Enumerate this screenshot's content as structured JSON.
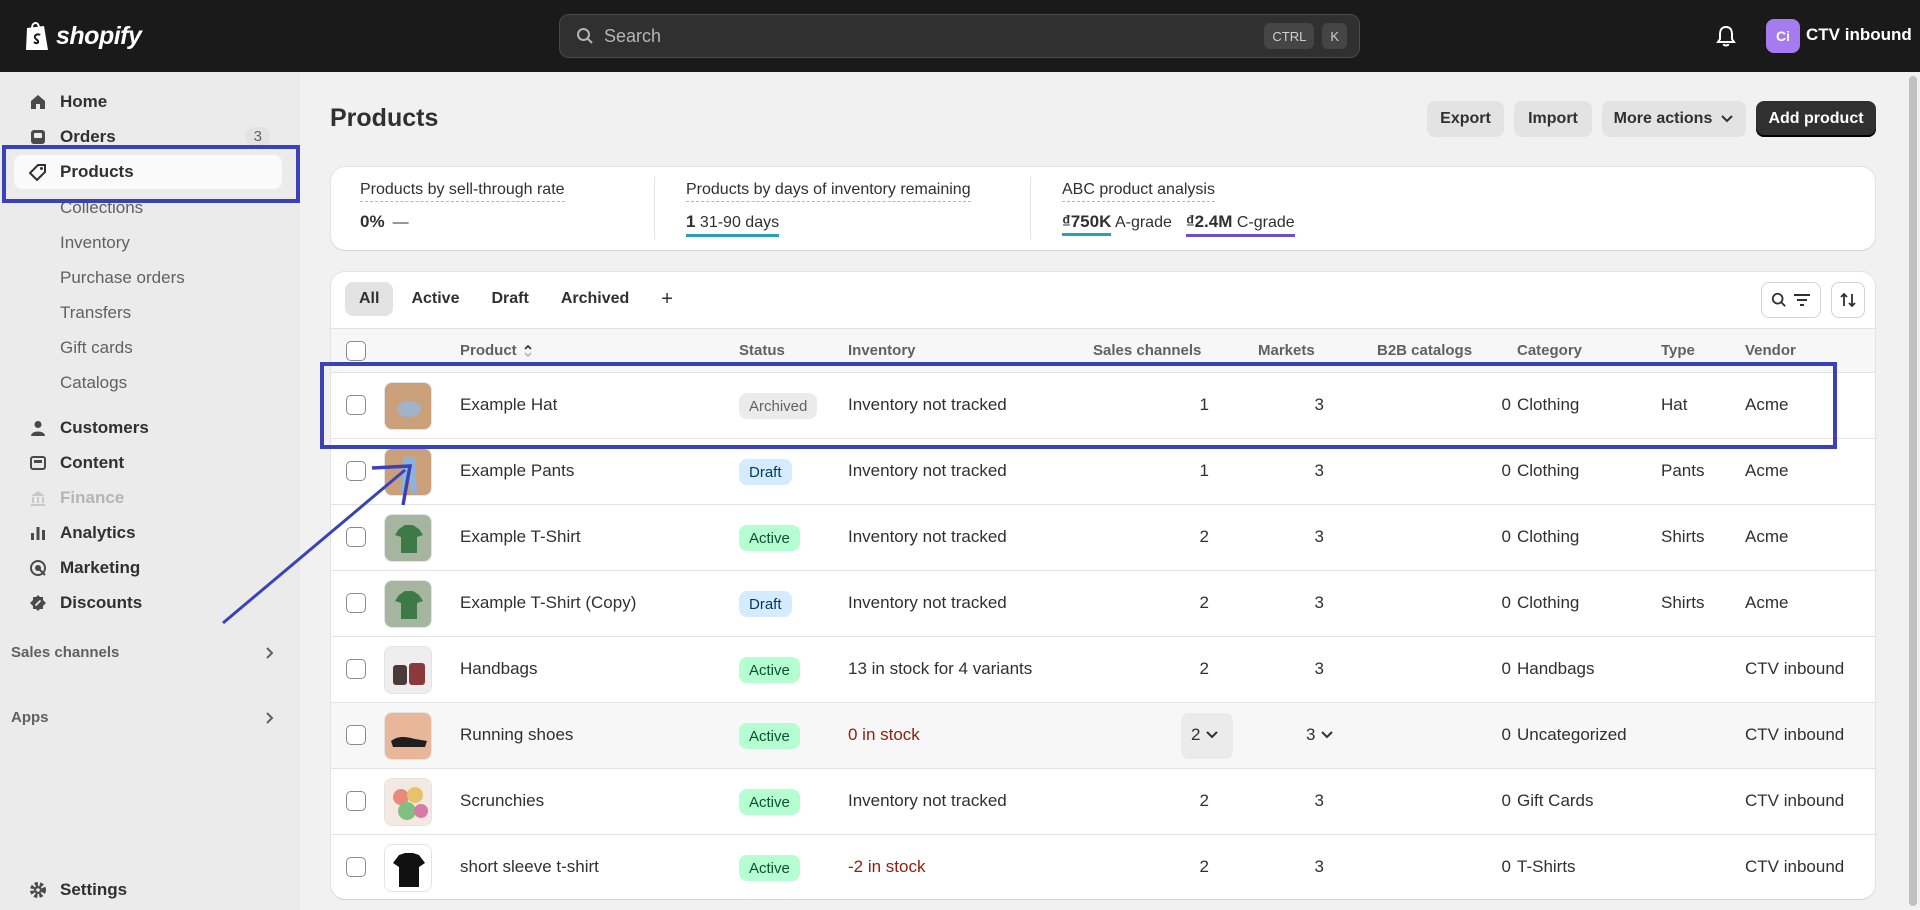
{
  "topbar": {
    "logo_text": "shopify",
    "search_placeholder": "Search",
    "shortcut_mod": "CTRL",
    "shortcut_key": "K",
    "avatar_initials": "Ci",
    "store_name": "CTV inbound"
  },
  "sidebar": {
    "items": [
      {
        "label": "Home",
        "icon": "home-icon"
      },
      {
        "label": "Orders",
        "icon": "orders-icon",
        "badge": "3"
      },
      {
        "label": "Products",
        "icon": "tag-icon"
      }
    ],
    "product_subitems": [
      "Collections",
      "Inventory",
      "Purchase orders",
      "Transfers",
      "Gift cards",
      "Catalogs"
    ],
    "items2": [
      {
        "label": "Customers",
        "icon": "person-icon"
      },
      {
        "label": "Content",
        "icon": "content-icon"
      },
      {
        "label": "Finance",
        "icon": "bank-icon"
      },
      {
        "label": "Analytics",
        "icon": "chart-icon"
      },
      {
        "label": "Marketing",
        "icon": "target-icon"
      },
      {
        "label": "Discounts",
        "icon": "discount-icon"
      }
    ],
    "sales_channels": "Sales channels",
    "apps": "Apps",
    "settings": "Settings"
  },
  "page": {
    "title": "Products",
    "export": "Export",
    "import": "Import",
    "more_actions": "More actions",
    "add_product": "Add product"
  },
  "analytics": {
    "m1_title": "Products by sell-through rate",
    "m1_value": "0%",
    "m1_trend": "—",
    "m2_title": "Products by days of inventory remaining",
    "m2_value": "1",
    "m2_label": "31-90 days",
    "m3_title": "ABC product analysis",
    "m3_a_value": "₫750K",
    "m3_a_label": "A-grade",
    "m3_c_value": "₫2.4M",
    "m3_c_label": "C-grade"
  },
  "tabs": [
    "All",
    "Active",
    "Draft",
    "Archived",
    "+"
  ],
  "columns": {
    "product": "Product",
    "status": "Status",
    "inventory": "Inventory",
    "sales_channels": "Sales channels",
    "markets": "Markets",
    "b2b": "B2B catalogs",
    "category": "Category",
    "type": "Type",
    "vendor": "Vendor"
  },
  "rows": [
    {
      "name": "Example Hat",
      "status": "Archived",
      "status_kind": "archived",
      "inventory": "Inventory not tracked",
      "inv_alert": false,
      "channels": "1",
      "markets": "3",
      "b2b": "0",
      "category": "Clothing",
      "type": "Hat",
      "vendor": "Acme"
    },
    {
      "name": "Example Pants",
      "status": "Draft",
      "status_kind": "draft",
      "inventory": "Inventory not tracked",
      "inv_alert": false,
      "channels": "1",
      "markets": "3",
      "b2b": "0",
      "category": "Clothing",
      "type": "Pants",
      "vendor": "Acme"
    },
    {
      "name": "Example T-Shirt",
      "status": "Active",
      "status_kind": "active",
      "inventory": "Inventory not tracked",
      "inv_alert": false,
      "channels": "2",
      "markets": "3",
      "b2b": "0",
      "category": "Clothing",
      "type": "Shirts",
      "vendor": "Acme"
    },
    {
      "name": "Example T-Shirt (Copy)",
      "status": "Draft",
      "status_kind": "draft",
      "inventory": "Inventory not tracked",
      "inv_alert": false,
      "channels": "2",
      "markets": "3",
      "b2b": "0",
      "category": "Clothing",
      "type": "Shirts",
      "vendor": "Acme"
    },
    {
      "name": "Handbags",
      "status": "Active",
      "status_kind": "active",
      "inventory": "13 in stock for 4 variants",
      "inv_alert": false,
      "channels": "2",
      "markets": "3",
      "b2b": "0",
      "category": "Handbags",
      "type": "",
      "vendor": "CTV inbound"
    },
    {
      "name": "Running shoes",
      "status": "Active",
      "status_kind": "active",
      "inventory": "0 in stock",
      "inv_alert": true,
      "channels": "2",
      "markets": "3",
      "b2b": "0",
      "category": "Uncategorized",
      "type": "",
      "vendor": "CTV inbound"
    },
    {
      "name": "Scrunchies",
      "status": "Active",
      "status_kind": "active",
      "inventory": "Inventory not tracked",
      "inv_alert": false,
      "channels": "2",
      "markets": "3",
      "b2b": "0",
      "category": "Gift Cards",
      "type": "",
      "vendor": "CTV inbound"
    },
    {
      "name": "short sleeve t-shirt",
      "status": "Active",
      "status_kind": "active",
      "inventory": "-2 in stock",
      "inv_alert": true,
      "channels": "2",
      "markets": "3",
      "b2b": "0",
      "category": "T-Shirts",
      "type": "",
      "vendor": "CTV inbound"
    }
  ],
  "colors": {
    "annotation": "#3b42b8",
    "topbar": "#1a1a1a",
    "accent_teal": "#27a3b0",
    "accent_purple": "#6a4fd0"
  }
}
